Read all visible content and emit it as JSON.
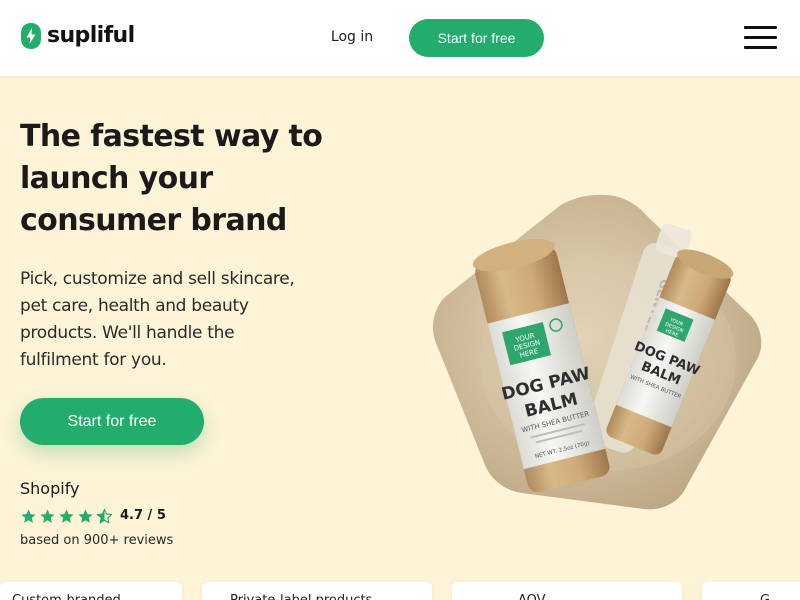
{
  "header": {
    "brand": "supliful",
    "login_label": "Log in",
    "cta_label": "Start for free",
    "menu_icon": "hamburger-menu-icon"
  },
  "hero": {
    "headline": "The fastest way to launch your consumer brand",
    "subtext": "Pick, customize and sell skincare, pet care, health and beauty products. We'll handle the fulfilment for you.",
    "cta_label": "Start for free"
  },
  "rating": {
    "source": "Shopify",
    "value": "4.7 / 5",
    "stars": 4.5,
    "count_text": "based on 900+ reviews"
  },
  "product_image": {
    "label_brand": "YOUR DESIGN HERE",
    "product_name": "DOG PAW BALM",
    "product_sub": "WITH SHEA BUTTER"
  },
  "colors": {
    "accent": "#23ad6c",
    "hero_bg": "#fdf3d6",
    "header_bg": "#ffffff"
  }
}
